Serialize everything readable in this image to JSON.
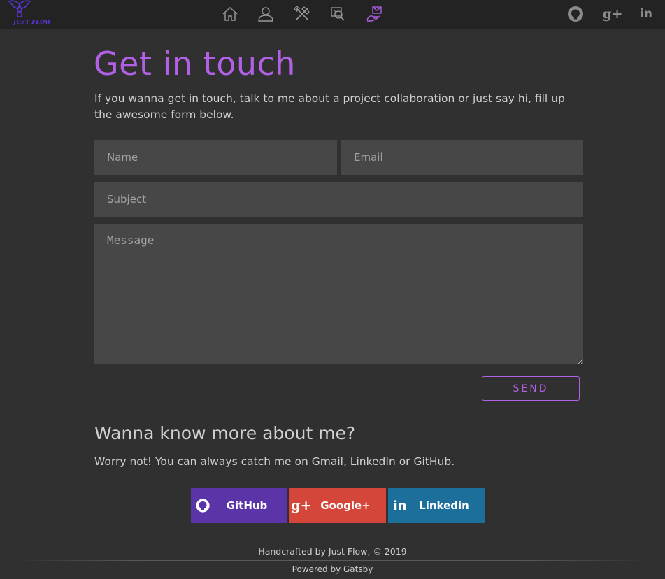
{
  "brand": {
    "logo_text": "JUST FLOW"
  },
  "nav": {
    "items": [
      {
        "icon": "home-icon"
      },
      {
        "icon": "user-icon"
      },
      {
        "icon": "tools-icon"
      },
      {
        "icon": "portfolio-search-icon"
      },
      {
        "icon": "contact-icon",
        "active": true
      }
    ],
    "social": [
      {
        "icon": "github-icon"
      },
      {
        "icon": "google-plus-icon",
        "text": "g+"
      },
      {
        "icon": "linkedin-icon",
        "text": "in"
      }
    ]
  },
  "contact": {
    "title": "Get in touch",
    "intro": "If you wanna get in touch, talk to me about a project collaboration or just say hi, fill up the awesome form below.",
    "form": {
      "name_placeholder": "Name",
      "email_placeholder": "Email",
      "subject_placeholder": "Subject",
      "message_placeholder": "Message",
      "send_label": "SEND"
    }
  },
  "about": {
    "heading": "Wanna know more about me?",
    "text": "Worry not! You can always catch me on Gmail, LinkedIn or GitHub.",
    "buttons": [
      {
        "label": "GitHub",
        "icon": "github-icon",
        "color": "#5b35a8"
      },
      {
        "label": "Google+",
        "icon": "google-plus-icon",
        "icon_text": "g+",
        "color": "#d34639"
      },
      {
        "label": "Linkedin",
        "icon": "linkedin-icon",
        "icon_text": "in",
        "color": "#1b6f9a"
      }
    ]
  },
  "footer": {
    "credit": "Handcrafted by Just Flow, © 2019",
    "powered": "Powered by Gatsby"
  },
  "colors": {
    "accent": "#b261e6",
    "background": "#303030",
    "topbar": "#232323",
    "field": "#474747",
    "text": "#d0d0d0"
  }
}
